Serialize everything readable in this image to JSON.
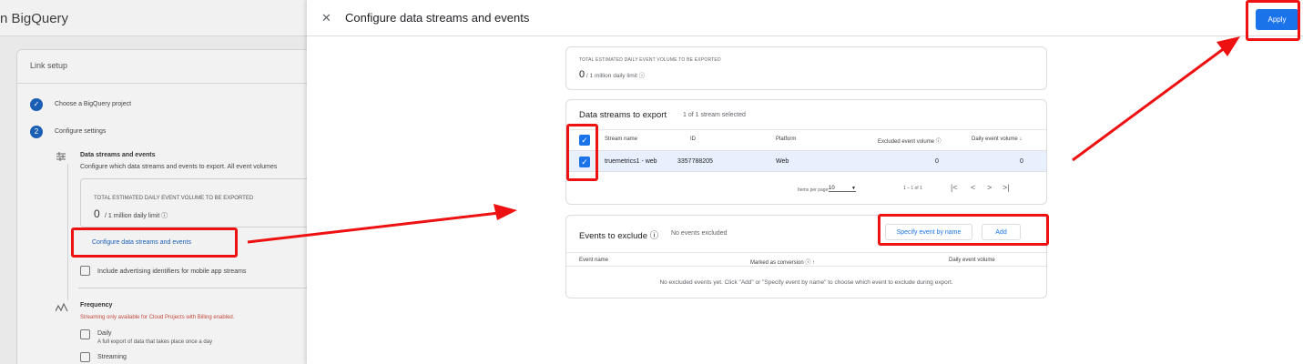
{
  "background": {
    "title": "n BigQuery",
    "card_title": "Link setup",
    "steps": [
      {
        "number": "✓",
        "label": "Choose a BigQuery project"
      },
      {
        "number": "2",
        "label": "Configure settings"
      }
    ],
    "data_streams": {
      "title": "Data streams and events",
      "desc": "Configure which data streams and events to export. All event volumes"
    },
    "volume": {
      "heading": "TOTAL ESTIMATED DAILY EVENT VOLUME TO BE EXPORTED",
      "value": "0",
      "limit": " / 1 million daily limit ⓘ"
    },
    "configure_link": "Configure data streams and events",
    "include_ads": "Include advertising identifiers for mobile app streams",
    "frequency": {
      "title": "Frequency",
      "note": "Streaming only available for Cloud Projects with Billing enabled.",
      "daily_label": "Daily",
      "daily_desc": "A full export of data that takes place once a day",
      "streaming_label": "Streaming"
    }
  },
  "panel": {
    "title": "Configure data streams and events",
    "apply_label": "Apply",
    "volume": {
      "heading": "TOTAL ESTIMATED DAILY EVENT VOLUME TO BE EXPORTED",
      "value": "0",
      "limit": " / 1 million daily limit ⓘ"
    },
    "streams": {
      "title": "Data streams to export",
      "count": "1 of 1 stream selected",
      "columns": {
        "name": "Stream name",
        "id": "ID",
        "platform": "Platform",
        "excluded": "Excluded event volume ⓘ",
        "daily": "Daily event volume ↓"
      },
      "rows": [
        {
          "name": "truemetrics1 - web",
          "id": "3357788205",
          "platform": "Web",
          "excluded": "0",
          "daily": "0"
        }
      ],
      "pagination": {
        "items_label": "Items per page:",
        "page_size": "10",
        "range": "1 – 1 of 1"
      }
    },
    "exclude": {
      "title": "Events to exclude ⓘ",
      "status": "No events excluded",
      "specify_label": "Specify event by name",
      "add_label": "Add",
      "columns": {
        "event": "Event name",
        "conversion": "Marked as conversion ⓘ ↑",
        "daily": "Daily event volume"
      },
      "empty": "No excluded events yet. Click \"Add\" or \"Specify event by name\" to choose which event to exclude during export."
    }
  },
  "colors": {
    "accent": "#1a73e8",
    "annotation": "#ee1111"
  }
}
